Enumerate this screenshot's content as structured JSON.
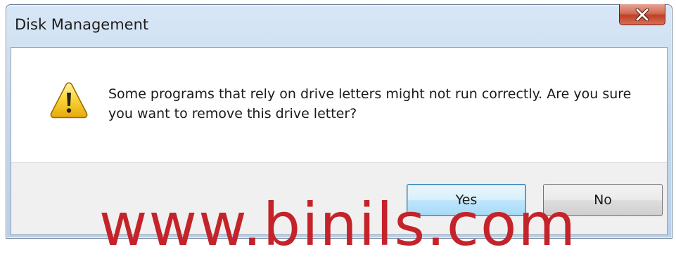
{
  "dialog": {
    "title": "Disk Management",
    "close_icon": "close-icon",
    "warning_icon": "warning-icon",
    "message": "Some programs that rely on drive letters might not run correctly. Are you sure you want to remove this drive letter?",
    "buttons": {
      "yes_label": "Yes",
      "no_label": "No"
    }
  },
  "watermark": {
    "text": "www.binils.com",
    "color": "#c4232a"
  },
  "colors": {
    "close_button": "#c7472c",
    "default_button_border": "#3c7fb1",
    "warning_yellow": "#f5c21b"
  }
}
